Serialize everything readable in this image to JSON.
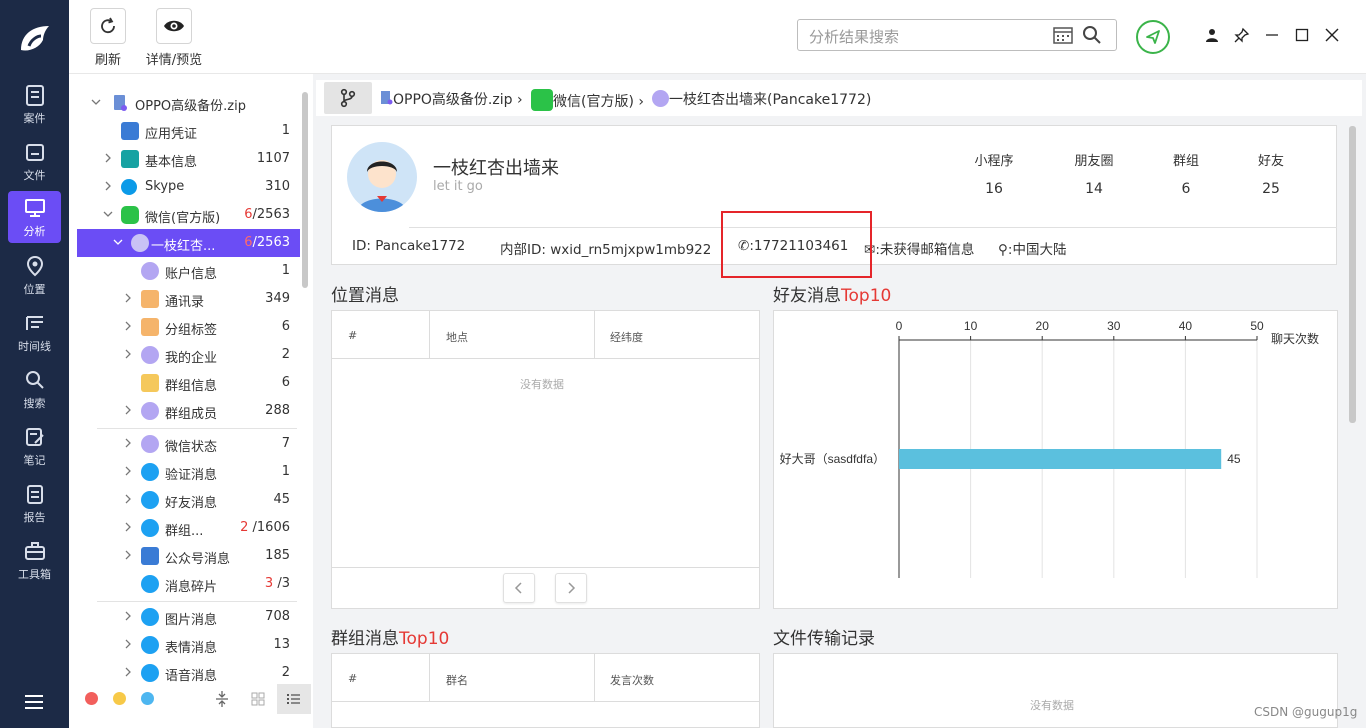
{
  "nav": {
    "items": [
      {
        "label": "案件"
      },
      {
        "label": "文件"
      },
      {
        "label": "分析"
      },
      {
        "label": "位置"
      },
      {
        "label": "时间线"
      },
      {
        "label": "搜索"
      },
      {
        "label": "笔记"
      },
      {
        "label": "报告"
      },
      {
        "label": "工具箱"
      }
    ]
  },
  "toolbar": {
    "refresh_label": "刷新",
    "detail_label": "详情/预览",
    "search_placeholder": "分析结果搜索"
  },
  "tree": {
    "root": {
      "label": "OPPO高级备份.zip"
    },
    "items": [
      {
        "label": "应用凭证",
        "count": "1"
      },
      {
        "label": "基本信息",
        "count": "1107"
      },
      {
        "label": "Skype",
        "count": "310"
      },
      {
        "label": "微信(官方版)",
        "count_red": "6",
        "count": "/2563"
      },
      {
        "label": "一枝红杏...",
        "count_red": "6",
        "count": "/2563"
      },
      {
        "label": "账户信息",
        "count": "1"
      },
      {
        "label": "通讯录",
        "count": "349"
      },
      {
        "label": "分组标签",
        "count": "6"
      },
      {
        "label": "我的企业",
        "count": "2"
      },
      {
        "label": "群组信息",
        "count": "6"
      },
      {
        "label": "群组成员",
        "count": "288"
      },
      {
        "label": "微信状态",
        "count": "7"
      },
      {
        "label": "验证消息",
        "count": "1"
      },
      {
        "label": "好友消息",
        "count": "45"
      },
      {
        "label": "群组...",
        "count_red": "2",
        "count": "/1606"
      },
      {
        "label": "公众号消息",
        "count": "185"
      },
      {
        "label": "消息碎片",
        "count_red": "3",
        "count": "/3"
      },
      {
        "label": "图片消息",
        "count": "708"
      },
      {
        "label": "表情消息",
        "count": "13"
      },
      {
        "label": "语音消息",
        "count": "2"
      }
    ]
  },
  "breadcrumb": {
    "c1": "OPPO高级备份.zip",
    "c2": "微信(官方版)",
    "c3": "一枝红杏出墙来(Pancake1772)"
  },
  "profile": {
    "name": "一枝红杏出墙来",
    "signature": "let it go",
    "stats": [
      {
        "label": "小程序",
        "value": "16"
      },
      {
        "label": "朋友圈",
        "value": "14"
      },
      {
        "label": "群组",
        "value": "6"
      },
      {
        "label": "好友",
        "value": "25"
      }
    ],
    "id": "ID: Pancake1772",
    "internal_id": "内部ID: wxid_rn5mjxpw1mb922",
    "phone": ":17721103461",
    "email": ":未获得邮箱信息",
    "location": ":中国大陆"
  },
  "location_section": {
    "title": "位置消息",
    "col1": "#",
    "col2": "地点",
    "col3": "经纬度",
    "empty": "没有数据"
  },
  "friend_section": {
    "title_main": "好友消息",
    "title_red": "Top10"
  },
  "group_section": {
    "title_main": "群组消息",
    "title_red": "Top10",
    "col1": "#",
    "col2": "群名",
    "col3": "发言次数"
  },
  "file_section": {
    "title": "文件传输记录",
    "empty": "没有数据"
  },
  "watermark": "CSDN @gugup1g",
  "chart_data": {
    "type": "bar",
    "orientation": "horizontal",
    "categories": [
      "好大哥（sasdfdfa）"
    ],
    "values": [
      45
    ],
    "xlabel": "聊天次数",
    "xlim": [
      0,
      50
    ],
    "xticks": [
      0,
      10,
      20,
      30,
      40,
      50
    ],
    "bar_color": "#5bc0de",
    "grid": true,
    "axis_position": "top"
  }
}
